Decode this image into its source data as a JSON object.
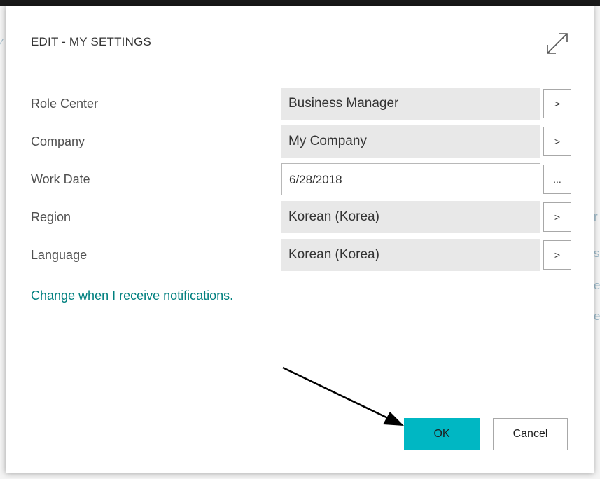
{
  "dialog": {
    "title": "EDIT - MY SETTINGS",
    "expand_icon": "expand-diagonal-icon"
  },
  "fields": [
    {
      "label": "Role Center",
      "value": "Business Manager",
      "button": ">"
    },
    {
      "label": "Company",
      "value": "My Company",
      "button": ">"
    },
    {
      "label": "Work Date",
      "value": "6/28/2018",
      "button": "..."
    },
    {
      "label": "Region",
      "value": "Korean (Korea)",
      "button": ">"
    },
    {
      "label": "Language",
      "value": "Korean (Korea)",
      "button": ">"
    }
  ],
  "notifications_link": "Change when I receive notifications.",
  "actions": {
    "ok_label": "OK",
    "cancel_label": "Cancel"
  },
  "colors": {
    "accent": "#00b7c3",
    "link": "#00807f",
    "readonly_field": "#e8e8e8"
  },
  "annotation": {
    "icon": "pointer-arrow-icon",
    "target": "ok-button"
  }
}
